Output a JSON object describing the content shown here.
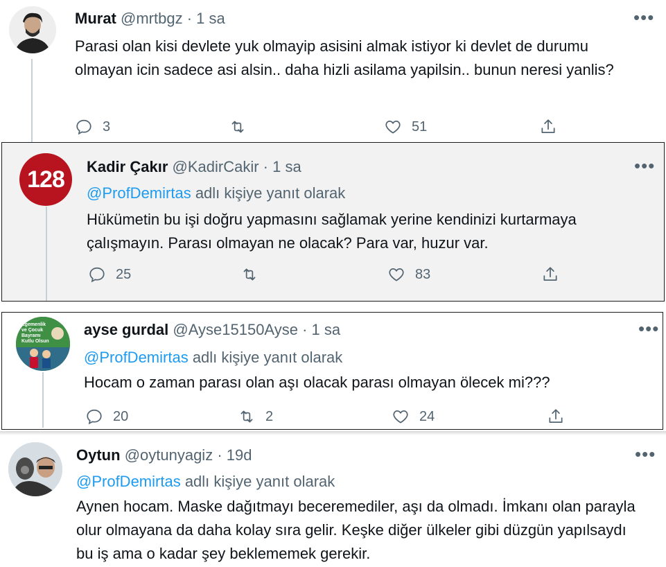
{
  "tweets": [
    {
      "name": "Murat",
      "handle": "@mrtbgz",
      "time": "· 1 sa",
      "reply_to": "",
      "reply_suffix": "",
      "text": "Parasi olan kisi devlete yuk olmayip asisini almak istiyor ki devlet de durumu olmayan icin sadece asi alsin.. daha hizli asilama yapilsin.. bunun neresi yanlis?",
      "replies": "3",
      "retweets": "",
      "likes": "51",
      "avatar_icon": "person-photo-avatar"
    },
    {
      "name": "Kadir Çakır",
      "handle": "@KadirCakir",
      "time": "· 1 sa",
      "reply_to": "@ProfDemirtas",
      "reply_suffix": " adlı kişiye yanıt olarak",
      "text": "Hükümetin bu işi doğru yapmasını sağlamak yerine kendinizi kurtarmaya çalışmayın. Parası olmayan ne olacak? Para var, huzur var.",
      "replies": "25",
      "retweets": "",
      "likes": "83",
      "avatar_text": "128"
    },
    {
      "name": "ayse gurdal",
      "handle": "@Ayse15150Ayse",
      "time": "· 1 sa",
      "reply_to": "@ProfDemirtas",
      "reply_suffix": " adlı kişiye yanıt olarak",
      "text": "Hocam o zaman parası olan aşı olacak parası olmayan ölecek mi???",
      "replies": "20",
      "retweets": "2",
      "likes": "24",
      "avatar_text": "Egemenlik ve Çocuk Bayramı Kutlu Olsun"
    },
    {
      "name": "Oytun",
      "handle": "@oytunyagiz",
      "time": "· 19d",
      "reply_to": "@ProfDemirtas",
      "reply_suffix": " adlı kişiye yanıt olarak",
      "text": "Aynen hocam. Maske dağıtmayı beceremediler, aşı da olmadı. İmkanı olan parayla olur olmayana da daha kolay sıra gelir. Keşke diğer ülkeler gibi düzgün yapılsaydı bu iş ama o kadar şey beklememek gerekir.",
      "avatar_icon": "person-photo-avatar"
    }
  ],
  "more_label": "•••",
  "colors": {
    "link": "#1d9bf0",
    "muted": "#536471",
    "badge_red": "#b8141f"
  }
}
